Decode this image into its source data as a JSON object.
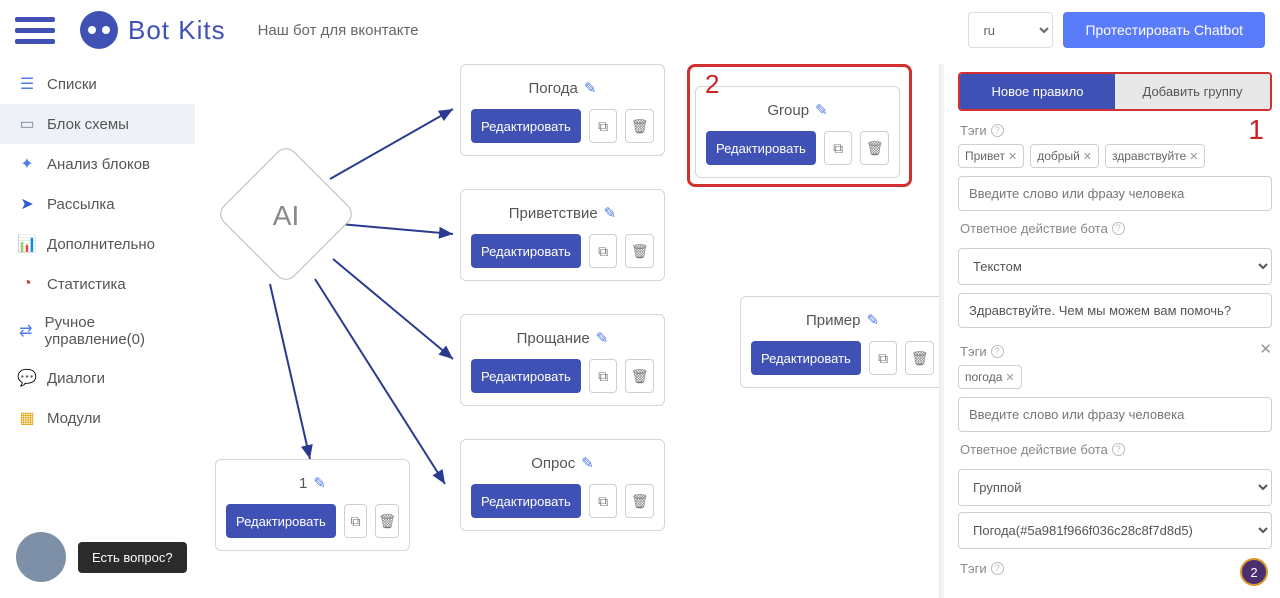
{
  "header": {
    "logo_text": "Bot Kits",
    "subtitle": "Наш бот для вконтакте",
    "lang": "ru",
    "test_btn": "Протестировать Chatbot"
  },
  "sidebar": {
    "items": [
      {
        "label": "Списки",
        "icon": "☰",
        "color": "#4f7de9"
      },
      {
        "label": "Блок схемы",
        "icon": "▭",
        "color": "#7c8aa3",
        "active": true
      },
      {
        "label": "Анализ блоков",
        "icon": "✦",
        "color": "#4f7de9"
      },
      {
        "label": "Рассылка",
        "icon": "➤",
        "color": "#2b5ed8"
      },
      {
        "label": "Дополнительно",
        "icon": "📊",
        "color": "#2a9d4a"
      },
      {
        "label": "Статистика",
        "icon": "◔",
        "color": "#c33"
      },
      {
        "label": "Ручное управление(0)",
        "icon": "⇄",
        "color": "#4f7de9"
      },
      {
        "label": "Диалоги",
        "icon": "💬",
        "color": "#4f7de9"
      },
      {
        "label": "Модули",
        "icon": "▦",
        "color": "#e6a817"
      }
    ]
  },
  "diamond": "AI",
  "cards": {
    "c1": {
      "title": "Погода"
    },
    "c2": {
      "title": "Приветствие"
    },
    "c3": {
      "title": "Прощание"
    },
    "c4": {
      "title": "Опрос"
    },
    "c5": {
      "title": "1"
    },
    "c6": {
      "title": "Group"
    },
    "c7": {
      "title": "Пример"
    }
  },
  "edit_label": "Редактировать",
  "rp": {
    "tab1": "Новое правило",
    "tab2": "Добавить группу",
    "tags_label": "Тэги",
    "tags1": [
      "Привет",
      "добрый",
      "здравствуйте"
    ],
    "input_ph": "Введите слово или фразу человека",
    "action_label": "Ответное действие бота",
    "action1": "Текстом",
    "answer1": "Здравствуйте. Чем мы можем вам помочь?",
    "tags2": [
      "погода"
    ],
    "action2": "Группой",
    "group_sel": "Погода(#5a981f966f036c28c8f7d8d5)"
  },
  "annotations": {
    "one": "1",
    "two": "2"
  },
  "help": "Есть вопрос?",
  "badge": "2"
}
